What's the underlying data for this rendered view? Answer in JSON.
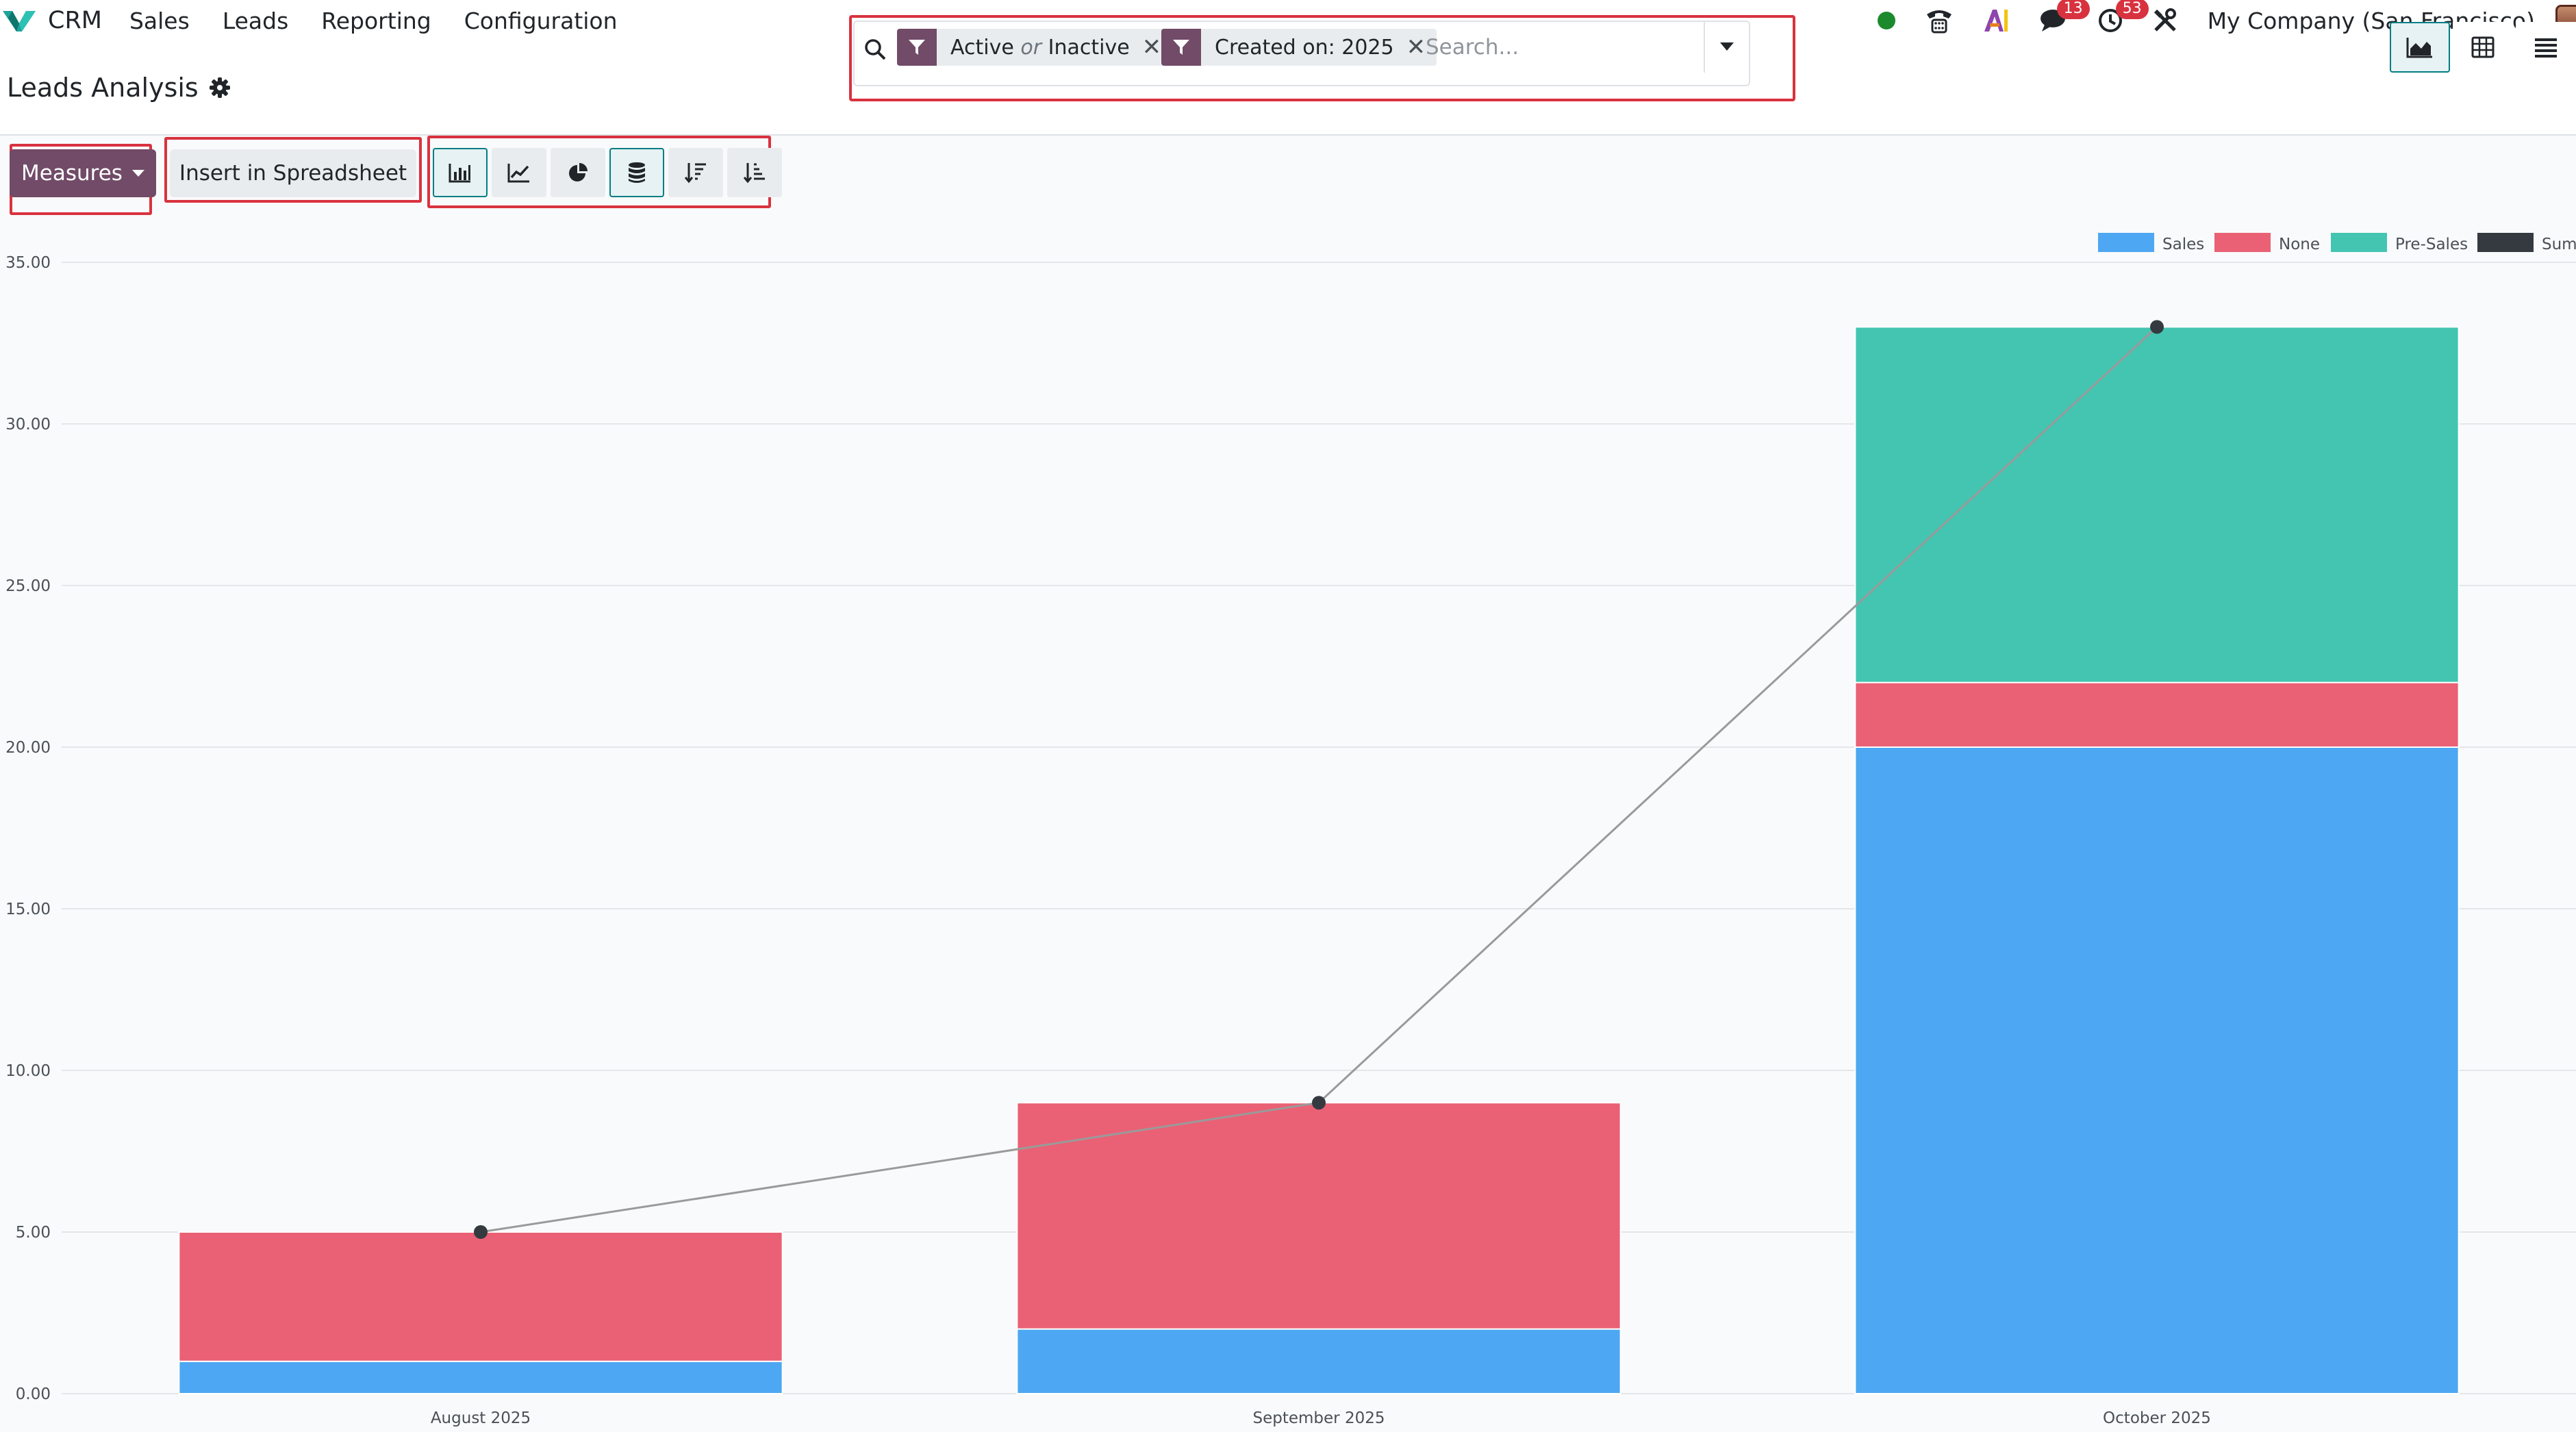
{
  "navbar": {
    "brand": "CRM",
    "menu": [
      "Sales",
      "Leads",
      "Reporting",
      "Configuration"
    ],
    "badges": {
      "messages": "13",
      "activities": "53"
    },
    "company": "My Company (San Francisco)"
  },
  "control_panel": {
    "title": "Leads Analysis",
    "facets": [
      {
        "part1": "Active",
        "connector": "or",
        "part2": "Inactive"
      },
      {
        "label": "Created on: 2025"
      }
    ],
    "search_placeholder": "Search..."
  },
  "toolbar": {
    "measures_label": "Measures",
    "spreadsheet_label": "Insert in Spreadsheet"
  },
  "colors": {
    "brand": "#714b67",
    "accent": "#017e84",
    "highlight": "#d9323f",
    "sales": "#4ea7f2",
    "none": "#ea6175",
    "presales": "#43c5b1",
    "sum": "#343a40"
  },
  "chart_data": {
    "type": "bar",
    "stacked": true,
    "categories": [
      "August 2025",
      "September 2025",
      "October 2025"
    ],
    "series": [
      {
        "name": "Sales",
        "color": "#4ea7f2",
        "values": [
          1,
          2,
          20
        ]
      },
      {
        "name": "None",
        "color": "#ea6175",
        "values": [
          4,
          7,
          2
        ]
      },
      {
        "name": "Pre-Sales",
        "color": "#43c5b1",
        "values": [
          0,
          0,
          11
        ]
      }
    ],
    "line": {
      "name": "Sum",
      "color": "#343a40",
      "values": [
        5,
        9,
        33
      ]
    },
    "yticks": [
      "0.00",
      "5.00",
      "10.00",
      "15.00",
      "20.00",
      "25.00",
      "30.00",
      "35.00"
    ],
    "ylim": [
      0,
      35
    ],
    "grid": true,
    "legend": "top-right"
  }
}
